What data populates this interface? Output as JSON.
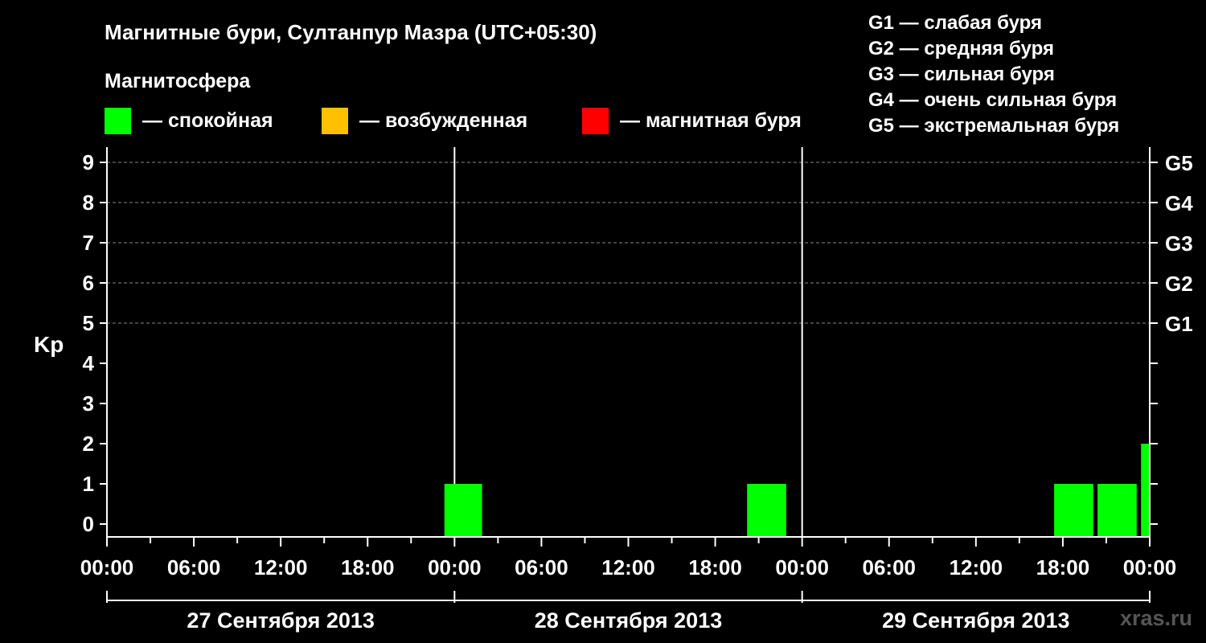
{
  "chart_data": {
    "type": "bar",
    "title": "Магнитные бури, Султанпур Мазра (UTC+05:30)",
    "legend_title": "Магнитосфера",
    "legend": [
      {
        "name": "— спокойная",
        "color": "#00ff00"
      },
      {
        "name": "— возбужденная",
        "color": "#ffc000"
      },
      {
        "name": "— магнитная буря",
        "color": "#ff0000"
      }
    ],
    "g_scale_legend": [
      "G1 — слабая буря",
      "G2 — средняя буря",
      "G3 — сильная буря",
      "G4 — очень сильная буря",
      "G5 — экстремальная буря"
    ],
    "ylabel": "Kp",
    "ylim": [
      0,
      9
    ],
    "y_ticks": [
      "0",
      "1",
      "2",
      "3",
      "4",
      "5",
      "6",
      "7",
      "8",
      "9"
    ],
    "right_axis_labels": [
      {
        "kp": 5,
        "label": "G1"
      },
      {
        "kp": 6,
        "label": "G2"
      },
      {
        "kp": 7,
        "label": "G3"
      },
      {
        "kp": 8,
        "label": "G4"
      },
      {
        "kp": 9,
        "label": "G5"
      }
    ],
    "x_range_hours": [
      0,
      72
    ],
    "x_tick_labels": [
      {
        "hour": 0,
        "label": "00:00"
      },
      {
        "hour": 6,
        "label": "06:00"
      },
      {
        "hour": 12,
        "label": "12:00"
      },
      {
        "hour": 18,
        "label": "18:00"
      },
      {
        "hour": 24,
        "label": "00:00"
      },
      {
        "hour": 30,
        "label": "06:00"
      },
      {
        "hour": 36,
        "label": "12:00"
      },
      {
        "hour": 42,
        "label": "18:00"
      },
      {
        "hour": 48,
        "label": "00:00"
      },
      {
        "hour": 54,
        "label": "06:00"
      },
      {
        "hour": 60,
        "label": "12:00"
      },
      {
        "hour": 66,
        "label": "18:00"
      },
      {
        "hour": 72,
        "label": "00:00"
      }
    ],
    "days": [
      "27 Сентября 2013",
      "28 Сентября 2013",
      "29 Сентября 2013"
    ],
    "day_boundaries_hours": [
      24,
      48
    ],
    "grid_horizontal_kp": [
      5,
      6,
      7,
      8,
      9
    ],
    "bars": [
      {
        "start": 23.3,
        "end": 25.9,
        "kp": 1,
        "color": "#00ff00"
      },
      {
        "start": 44.2,
        "end": 46.9,
        "kp": 1,
        "color": "#00ff00"
      },
      {
        "start": 65.4,
        "end": 68.1,
        "kp": 1,
        "color": "#00ff00"
      },
      {
        "start": 68.4,
        "end": 71.1,
        "kp": 1,
        "color": "#00ff00"
      },
      {
        "start": 71.4,
        "end": 72.0,
        "kp": 2,
        "color": "#00ff00"
      }
    ]
  },
  "watermark": "xras.ru"
}
